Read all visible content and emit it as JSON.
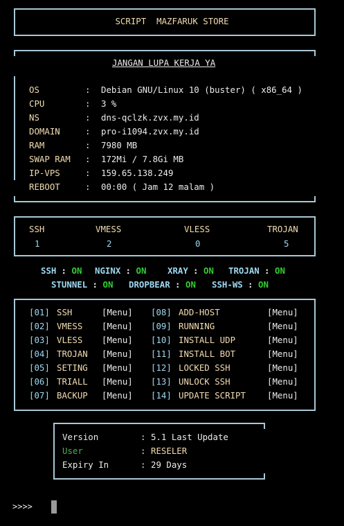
{
  "header": {
    "title": "SCRIPT  MAZFARUK STORE"
  },
  "info": {
    "heading": "JANGAN LUPA KERJA YA",
    "rows": [
      {
        "label": "OS",
        "value": "Debian GNU/Linux 10 (buster) ( x86_64 )"
      },
      {
        "label": "CPU",
        "value": "3 %"
      },
      {
        "label": "NS",
        "value": "dns-qclzk.zvx.my.id"
      },
      {
        "label": "DOMAIN",
        "value": "pro-i1094.zvx.my.id"
      },
      {
        "label": "RAM",
        "value": "7980 MB"
      },
      {
        "label": "SWAP RAM",
        "value": "172Mi / 7.8Gi MB"
      },
      {
        "label": "IP-VPS",
        "value": "159.65.138.249"
      },
      {
        "label": "REBOOT",
        "value": "00:00 ( Jam 12 malam )"
      }
    ],
    "separator": ":"
  },
  "accounts": {
    "items": [
      {
        "label": "SSH",
        "count": "1"
      },
      {
        "label": "VMESS",
        "count": "2"
      },
      {
        "label": "VLESS",
        "count": "0"
      },
      {
        "label": "TROJAN",
        "count": "5"
      }
    ]
  },
  "services": {
    "line1": [
      {
        "name": "SSH",
        "status": "ON"
      },
      {
        "name": "NGINX",
        "status": "ON"
      },
      {
        "name": "XRAY",
        "status": "ON"
      },
      {
        "name": "TROJAN",
        "status": "ON"
      }
    ],
    "line2": [
      {
        "name": "STUNNEL",
        "status": "ON"
      },
      {
        "name": "DROPBEAR",
        "status": "ON"
      },
      {
        "name": "SSH-WS",
        "status": "ON"
      }
    ],
    "sep": ":"
  },
  "menu": {
    "tag": "[Menu]",
    "left": [
      {
        "num": "[01]",
        "name": "SSH"
      },
      {
        "num": "[02]",
        "name": "VMESS"
      },
      {
        "num": "[03]",
        "name": "VLESS"
      },
      {
        "num": "[04]",
        "name": "TROJAN"
      },
      {
        "num": "[05]",
        "name": "SETING"
      },
      {
        "num": "[06]",
        "name": "TRIALL"
      },
      {
        "num": "[07]",
        "name": "BACKUP"
      }
    ],
    "right": [
      {
        "num": "[08]",
        "name": "ADD-HOST"
      },
      {
        "num": "[09]",
        "name": "RUNNING"
      },
      {
        "num": "[10]",
        "name": "INSTALL UDP"
      },
      {
        "num": "[11]",
        "name": "INSTALL BOT"
      },
      {
        "num": "[12]",
        "name": "LOCKED SSH"
      },
      {
        "num": "[13]",
        "name": "UNLOCK SSH"
      },
      {
        "num": "[14]",
        "name": "UPDATE SCRIPT"
      }
    ]
  },
  "version": {
    "rows": [
      {
        "label": "Version",
        "value": "5.1 Last Update"
      },
      {
        "label": "User",
        "value": "RESELER"
      },
      {
        "label": "Expiry In",
        "value": "29 Days"
      }
    ],
    "sep": ":"
  },
  "prompt": {
    "text": ">>>>"
  },
  "colors": {
    "border": "#a9c8d6",
    "label": "#f3ddb0",
    "on": "#32cd32",
    "menu_num": "#9fd8f0"
  }
}
